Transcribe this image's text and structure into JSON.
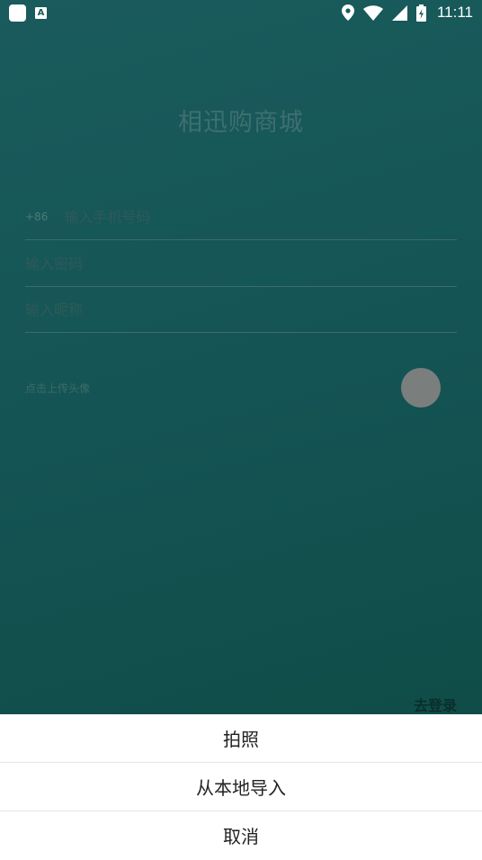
{
  "status_bar": {
    "notification_a": "A",
    "time": "11:11"
  },
  "app": {
    "title": "相迅购商城"
  },
  "form": {
    "country_code": "+86",
    "phone_placeholder": "输入手机号码",
    "password_placeholder": "输入密码",
    "nickname_placeholder": "输入昵称",
    "avatar_label": "点击上传头像"
  },
  "go_login": "去登录",
  "sheet": {
    "items": [
      {
        "label": "拍照"
      },
      {
        "label": "从本地导入"
      },
      {
        "label": "取消"
      }
    ]
  },
  "colors": {
    "background_top": "#1a5b5d",
    "background_bottom": "#0e4a44",
    "avatar_placeholder": "#7a7f7e",
    "sheet_background": "#ffffff"
  },
  "icons": {
    "status": [
      "notification-icon",
      "a-icon",
      "location-icon",
      "wifi-icon",
      "signal-icon",
      "battery-icon"
    ]
  }
}
